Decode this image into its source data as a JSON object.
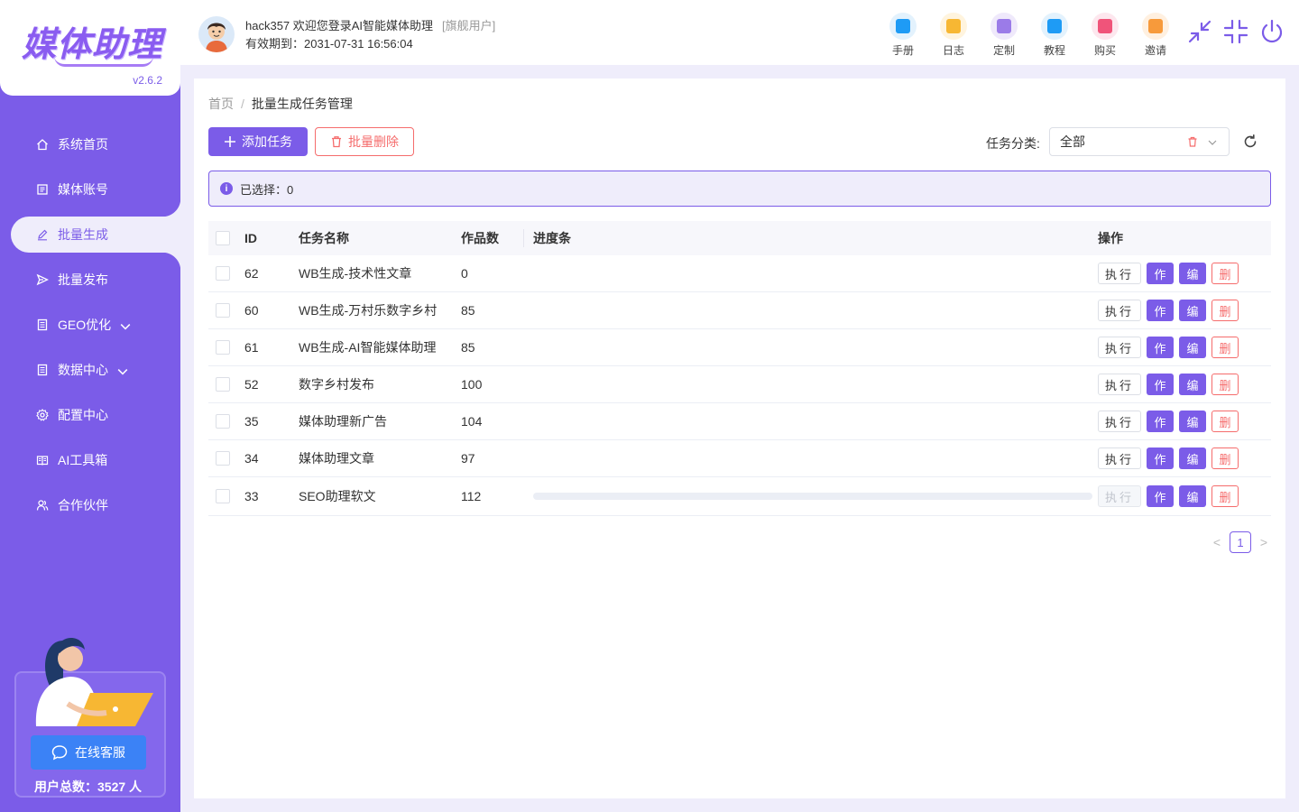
{
  "app": {
    "logo_text": "媒体助理",
    "version": "v2.6.2"
  },
  "sidebar": {
    "items": [
      {
        "label": "系统首页",
        "icon": "home-icon"
      },
      {
        "label": "媒体账号",
        "icon": "account-icon"
      },
      {
        "label": "批量生成",
        "icon": "edit-icon",
        "active": true
      },
      {
        "label": "批量发布",
        "icon": "send-icon"
      },
      {
        "label": "GEO优化",
        "icon": "doc-icon",
        "expandable": true
      },
      {
        "label": "数据中心",
        "icon": "doc-icon",
        "expandable": true
      },
      {
        "label": "配置中心",
        "icon": "gear-icon"
      },
      {
        "label": "AI工具箱",
        "icon": "book-icon"
      },
      {
        "label": "合作伙伴",
        "icon": "partner-icon"
      }
    ],
    "support_button": "在线客服",
    "user_total": "用户总数：3527 人"
  },
  "header": {
    "greeting": "hack357 欢迎您登录AI智能媒体助理",
    "user_tag": "[旗舰用户]",
    "expiry": "有效期到：2031-07-31 16:56:04",
    "tools": [
      {
        "label": "手册",
        "icon": "manual-icon",
        "color": "#1e9bf5",
        "bg": "#e3f2fd"
      },
      {
        "label": "日志",
        "icon": "log-icon",
        "color": "#f7b733",
        "bg": "#fff4de"
      },
      {
        "label": "定制",
        "icon": "custom-icon",
        "color": "#9b7be8",
        "bg": "#efe9fb"
      },
      {
        "label": "教程",
        "icon": "tutorial-icon",
        "color": "#1e9bf5",
        "bg": "#e3f2fd"
      },
      {
        "label": "购买",
        "icon": "buy-icon",
        "color": "#f0547a",
        "bg": "#fde7ee"
      },
      {
        "label": "邀请",
        "icon": "invite-icon",
        "color": "#f79a3b",
        "bg": "#fff0e0"
      }
    ]
  },
  "breadcrumb": {
    "home": "首页",
    "separator": "/",
    "current": "批量生成任务管理"
  },
  "toolbar": {
    "add_label": "添加任务",
    "delete_label": "批量删除",
    "filter_label": "任务分类:",
    "filter_value": "全部"
  },
  "selection": {
    "text": "已选择：0"
  },
  "table": {
    "columns": [
      "ID",
      "任务名称",
      "作品数",
      "进度条",
      "操作"
    ],
    "rows": [
      {
        "id": "62",
        "name": "WB生成-技术性文章",
        "count": "0",
        "progress": null,
        "exec_disabled": false
      },
      {
        "id": "60",
        "name": "WB生成-万村乐数字乡村",
        "count": "85",
        "progress": null,
        "exec_disabled": false
      },
      {
        "id": "61",
        "name": "WB生成-AI智能媒体助理",
        "count": "85",
        "progress": null,
        "exec_disabled": false
      },
      {
        "id": "52",
        "name": "数字乡村发布",
        "count": "100",
        "progress": null,
        "exec_disabled": false
      },
      {
        "id": "35",
        "name": "媒体助理新广告",
        "count": "104",
        "progress": null,
        "exec_disabled": false
      },
      {
        "id": "34",
        "name": "媒体助理文章",
        "count": "97",
        "progress": null,
        "exec_disabled": false
      },
      {
        "id": "33",
        "name": "SEO助理软文",
        "count": "112",
        "progress": 0,
        "exec_disabled": true
      }
    ],
    "actions": {
      "exec": "执行",
      "work": "作",
      "edit": "编",
      "delete": "删"
    }
  },
  "pagination": {
    "prev": "<",
    "current": "1",
    "next": ">"
  },
  "colors": {
    "accent": "#7b5ce8",
    "danger": "#f56c6c",
    "support_blue": "#3b82f6"
  }
}
